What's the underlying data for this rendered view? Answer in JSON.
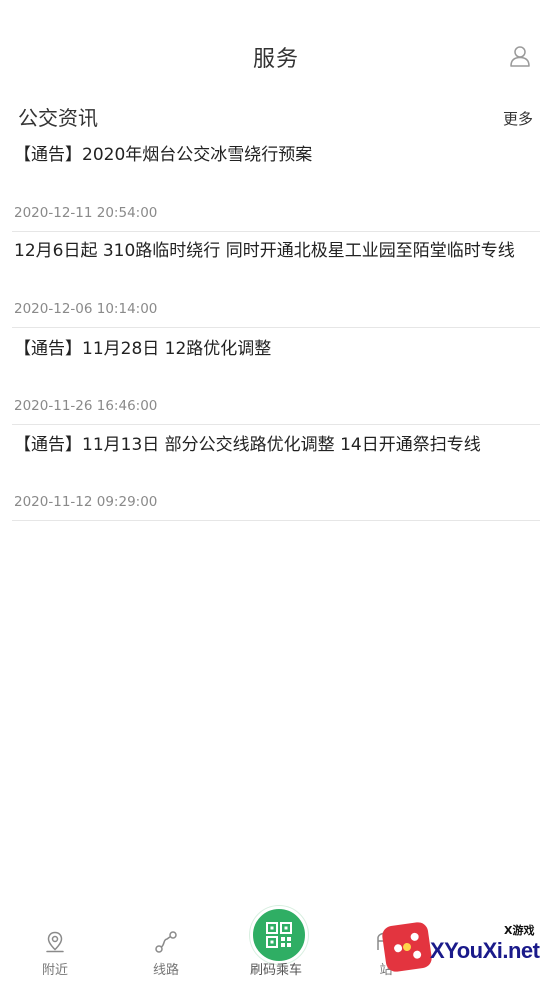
{
  "header": {
    "title": "服务",
    "profile_icon": "user-icon"
  },
  "section": {
    "title": "公交资讯",
    "more_label": "更多"
  },
  "news": [
    {
      "title": "【通告】2020年烟台公交冰雪绕行预案",
      "date": "2020-12-11 20:54:00"
    },
    {
      "title": "12月6日起 310路临时绕行 同时开通北极星工业园至陌堂临时专线",
      "date": "2020-12-06 10:14:00"
    },
    {
      "title": "【通告】11月28日 12路优化调整",
      "date": "2020-11-26 16:46:00"
    },
    {
      "title": "【通告】11月13日 部分公交线路优化调整 14日开通祭扫专线",
      "date": "2020-11-12 09:29:00"
    }
  ],
  "bottom_nav": {
    "items": [
      {
        "label": "附近",
        "icon": "location-pin-icon"
      },
      {
        "label": "线路",
        "icon": "route-icon"
      },
      {
        "label": "刷码乘车",
        "icon": "qr-code-icon"
      },
      {
        "label": "站",
        "icon": "station-icon"
      }
    ],
    "accent_color": "#2fae64"
  },
  "watermark": {
    "brand": "XYouXi.net",
    "small_text": "X游戏"
  }
}
